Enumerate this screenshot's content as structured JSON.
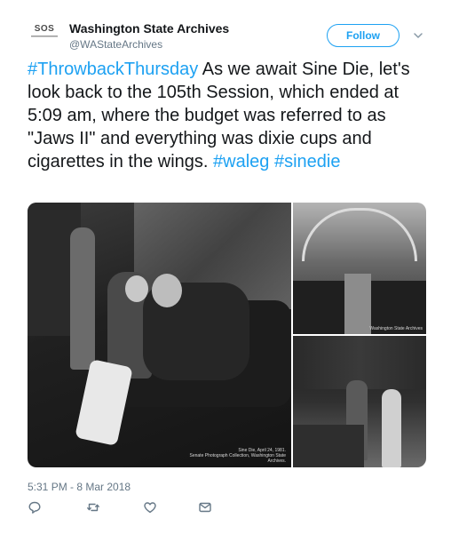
{
  "account": {
    "logo_text": "SOS",
    "display_name": "Washington State Archives",
    "handle": "@WAStateArchives"
  },
  "follow_button": {
    "label": "Follow"
  },
  "tweet": {
    "hashtag_lead": "#ThrowbackThursday",
    "body": " As we await Sine Die, let's look back to the 105th Session, which ended at 5:09 am, where the budget was referred to as \"Jaws II\" and everything was dixie cups and cigarettes in the wings.",
    "hashtag_1": "#waleg",
    "hashtag_2": "#sinedie"
  },
  "media": {
    "main_caption_line1": "Sine Die, April 24, 1981.",
    "main_caption_line2": "Senate Photograph Collection, Washington State Archives.",
    "top_right_caption": "Washington State Archives"
  },
  "timestamp": "5:31 PM - 8 Mar 2018",
  "actions": {
    "reply": "reply-icon",
    "retweet": "retweet-icon",
    "like": "heart-icon",
    "message": "envelope-icon"
  },
  "colors": {
    "accent": "#1da1f2",
    "text": "#14171a",
    "secondary": "#657786"
  }
}
